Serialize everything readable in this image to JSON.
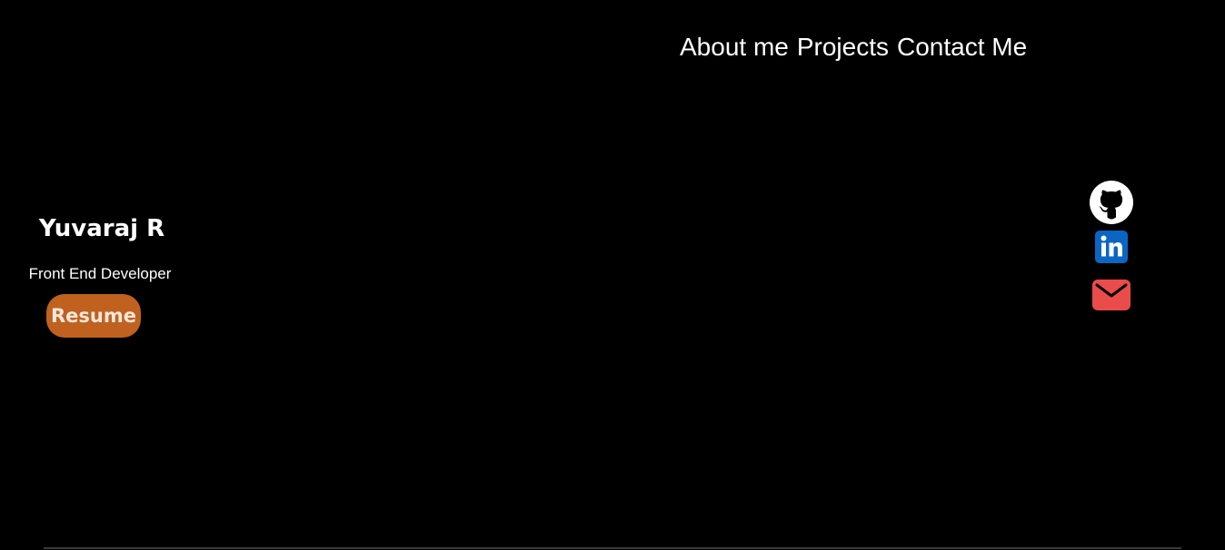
{
  "nav": {
    "items": [
      {
        "label": "About me"
      },
      {
        "label": "Projects"
      },
      {
        "label": "Contact Me"
      }
    ]
  },
  "profile": {
    "name": "Yuvaraj R",
    "role": "Front End Developer",
    "resume_label": "Resume"
  },
  "socials": [
    {
      "icon": "github-icon",
      "color": "#ffffff"
    },
    {
      "icon": "linkedin-icon",
      "color": "#0a66c2"
    },
    {
      "icon": "mail-icon",
      "color": "#ea4c4c"
    }
  ],
  "colors": {
    "background": "#000000",
    "text": "#ffffff",
    "resume_button": "#c0611f",
    "resume_text": "#f3e7dc"
  }
}
